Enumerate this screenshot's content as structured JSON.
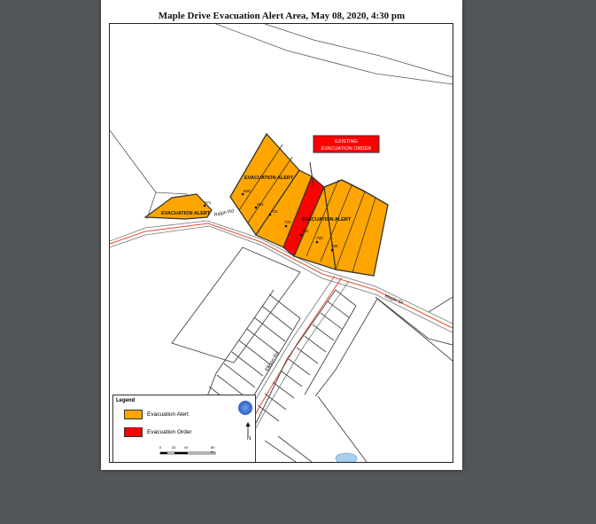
{
  "title": "Maple Drive Evacuation Alert Area, May 08, 2020, 4:30 pm",
  "colors": {
    "evacuation_alert": "#FFA500",
    "evacuation_order": "#FF0000",
    "road": "#e0543a",
    "water": "#a5cff0"
  },
  "zone_labels": {
    "alert_left": "EVACUATION ALERT",
    "alert_north": "EVACUATION ALERT",
    "alert_south": "EVACUATION ALERT",
    "existing_order_line1": "EXISTING",
    "existing_order_line2": "EVACUATION ORDER"
  },
  "roads": {
    "ralph_rd": "Ralph Rd",
    "maple_dr": "Maple Dr",
    "ellison_rd": "Ellison Rd"
  },
  "addresses": [
    "671",
    "660",
    "682",
    "702",
    "720",
    "734",
    "750",
    "768"
  ],
  "legend": {
    "title": "Legend",
    "items": [
      {
        "label": "Evacuation Alert",
        "color": "#FFA500"
      },
      {
        "label": "Evacuation Order",
        "color": "#FF0000"
      }
    ],
    "scale_ticks": [
      "0",
      "20",
      "40",
      "80 m"
    ],
    "north": "N"
  }
}
